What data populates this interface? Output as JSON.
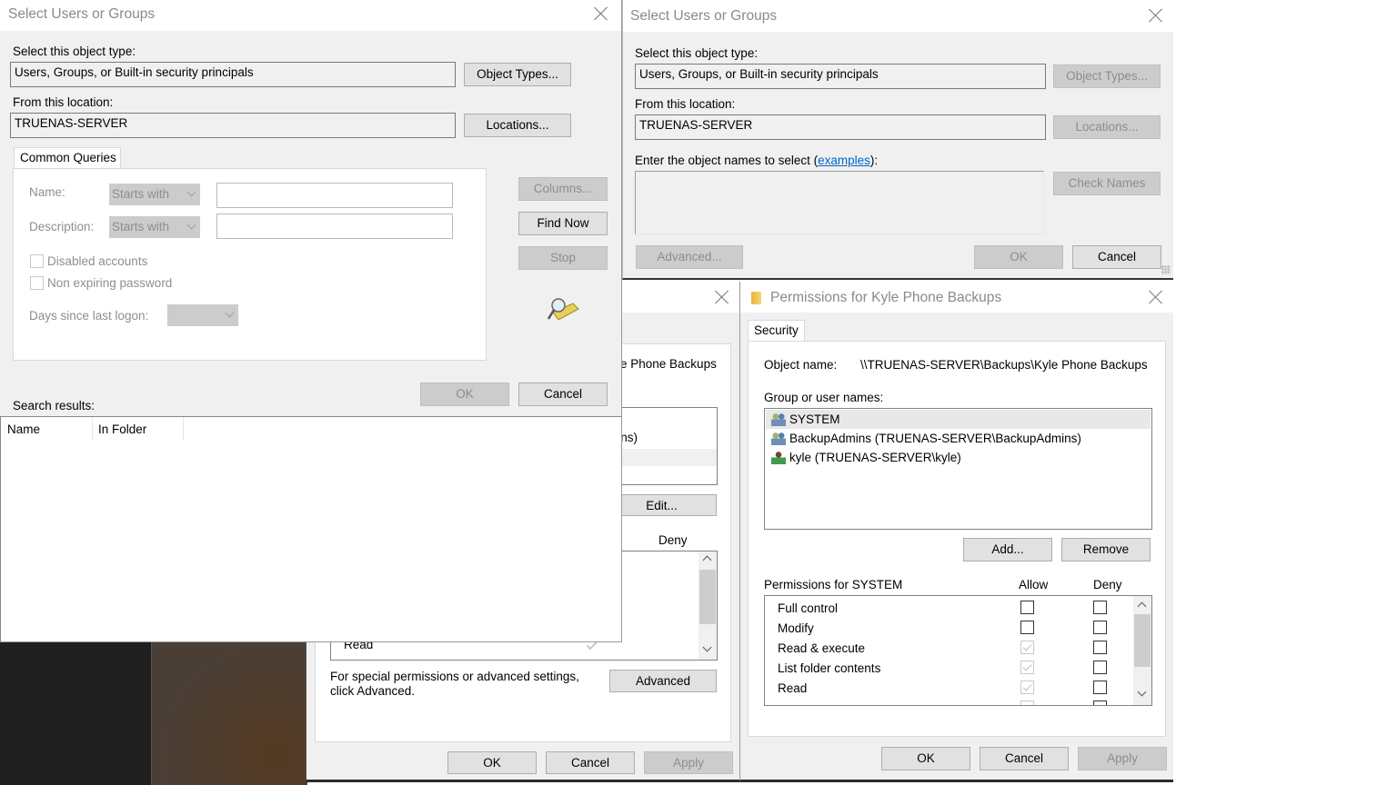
{
  "desktop": {
    "colors": {
      "dark": "#1f1f1f",
      "brown": "#4a3a2c"
    }
  },
  "properties_dialog": {
    "object_name_fragment": "e Phone Backups",
    "user_fragment": "mins)",
    "edit_label": "Edit...",
    "deny_header": "Deny",
    "perm_visible_row": "Read",
    "advanced_hint": "For special permissions or advanced settings, click Advanced.",
    "advanced_label": "Advanced",
    "ok_label": "OK",
    "cancel_label": "Cancel",
    "apply_label": "Apply"
  },
  "permissions_dialog": {
    "title": "Permissions for Kyle Phone Backups",
    "tab": "Security",
    "object_name_label": "Object name:",
    "object_name_value": "\\\\TRUENAS-SERVER\\Backups\\Kyle Phone Backups",
    "group_label": "Group or user names:",
    "users": [
      {
        "name": "SYSTEM",
        "icon": "group-icon",
        "selected": true
      },
      {
        "name": "BackupAdmins (TRUENAS-SERVER\\BackupAdmins)",
        "icon": "group-icon",
        "selected": false
      },
      {
        "name": "kyle (TRUENAS-SERVER\\kyle)",
        "icon": "user-icon",
        "selected": false
      }
    ],
    "add_label": "Add...",
    "remove_label": "Remove",
    "perm_header": "Permissions for SYSTEM",
    "allow_header": "Allow",
    "deny_header": "Deny",
    "permissions": [
      {
        "name": "Full control",
        "allow": false,
        "allow_inherited": false,
        "deny": false
      },
      {
        "name": "Modify",
        "allow": false,
        "allow_inherited": false,
        "deny": false
      },
      {
        "name": "Read & execute",
        "allow": true,
        "allow_inherited": true,
        "deny": false
      },
      {
        "name": "List folder contents",
        "allow": true,
        "allow_inherited": true,
        "deny": false
      },
      {
        "name": "Read",
        "allow": true,
        "allow_inherited": true,
        "deny": false
      }
    ],
    "ok_label": "OK",
    "cancel_label": "Cancel",
    "apply_label": "Apply"
  },
  "select_dialog_back": {
    "title": "Select Users or Groups",
    "object_type_label": "Select this object type:",
    "object_type_value": "Users, Groups, or Built-in security principals",
    "object_types_btn": "Object Types...",
    "location_label": "From this location:",
    "location_value": "TRUENAS-SERVER",
    "locations_btn": "Locations...",
    "enter_label_prefix": "Enter the object names to select (",
    "examples_link": "examples",
    "enter_label_suffix": "):",
    "object_names_value": "",
    "check_names_btn": "Check Names",
    "advanced_btn": "Advanced...",
    "ok_label": "OK",
    "cancel_label": "Cancel",
    "link_color": "#0066cc"
  },
  "select_dialog_front": {
    "title": "Select Users or Groups",
    "object_type_label": "Select this object type:",
    "object_type_value": "Users, Groups, or Built-in security principals",
    "object_types_btn": "Object Types...",
    "location_label": "From this location:",
    "location_value": "TRUENAS-SERVER",
    "locations_btn": "Locations...",
    "tab": "Common Queries",
    "name_label": "Name:",
    "name_mode": "Starts with",
    "name_value": "",
    "description_label": "Description:",
    "description_mode": "Starts with",
    "description_value": "",
    "disabled_accounts": "Disabled accounts",
    "non_expiring": "Non expiring password",
    "days_label": "Days since last logon:",
    "days_value": "",
    "columns_btn": "Columns...",
    "find_now_btn": "Find Now",
    "stop_btn": "Stop",
    "ok_label": "OK",
    "cancel_label": "Cancel",
    "search_results_label": "Search results:",
    "columns": [
      "Name",
      "In Folder"
    ]
  }
}
